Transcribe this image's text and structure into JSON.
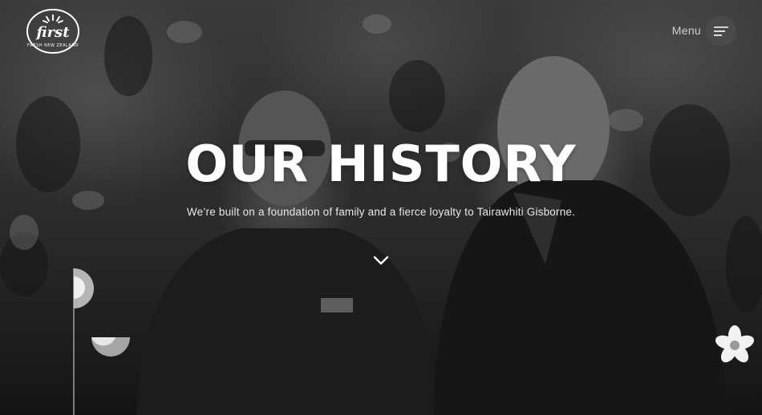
{
  "header": {
    "brand_lines": [
      "first",
      "FRESH NEW ZEALAND"
    ],
    "menu_label": "Menu"
  },
  "hero": {
    "title": "OUR HISTORY",
    "subtitle": "We’re built on a foundation of family and a fierce loyalty to Tairawhiti Gisborne."
  },
  "icons": {
    "menu": "hamburger-icon",
    "scroll": "chevron-down-icon",
    "flower": "flower-icon"
  },
  "colors": {
    "text": "#ffffff",
    "menu_button_bg": "#4a4a4a"
  }
}
